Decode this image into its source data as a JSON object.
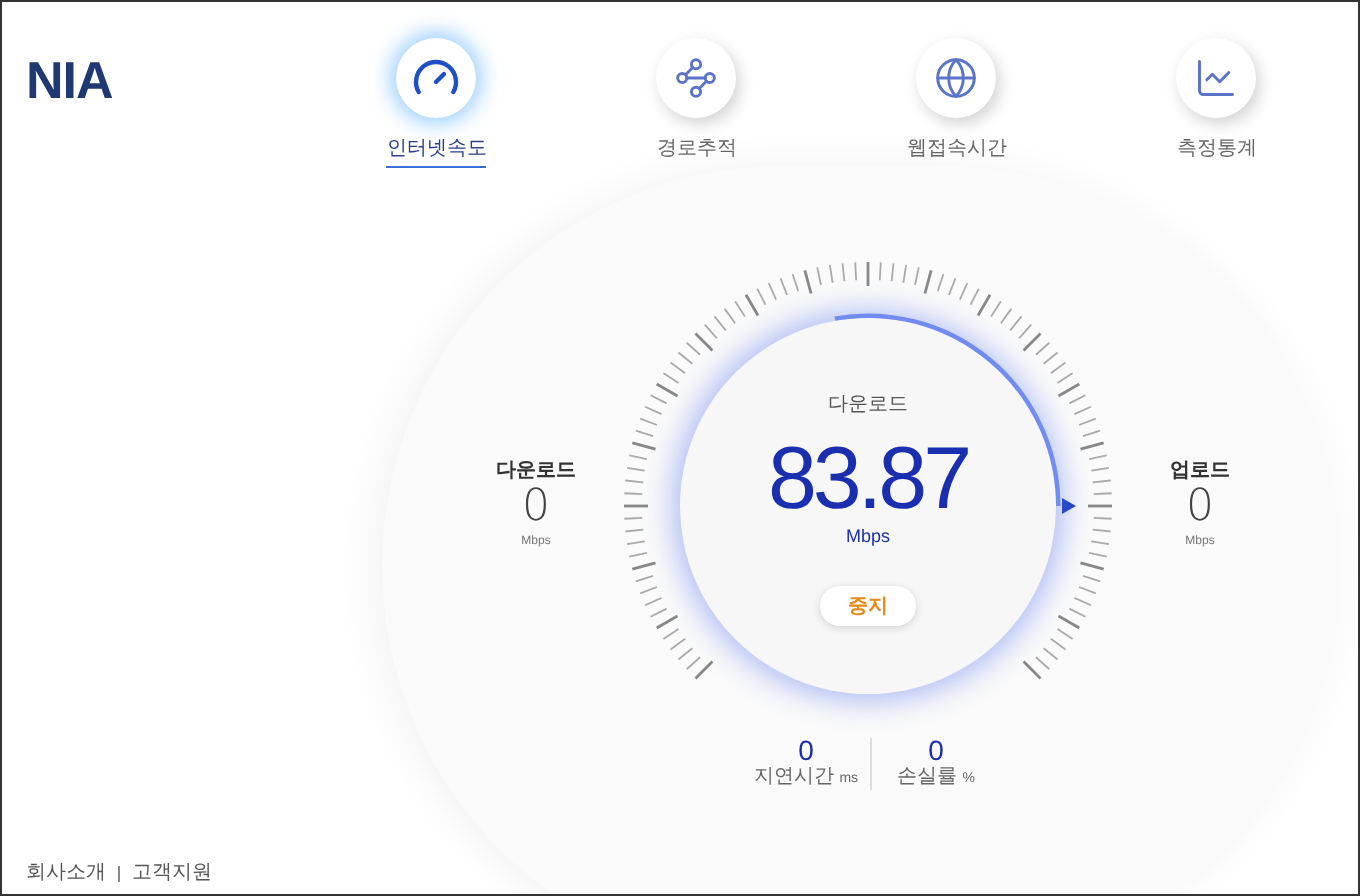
{
  "logo": "NIA",
  "tabs": [
    {
      "label": "인터넷속도",
      "selected": true
    },
    {
      "label": "경로추적",
      "selected": false
    },
    {
      "label": "웹접속시간",
      "selected": false
    },
    {
      "label": "측정통계",
      "selected": false
    }
  ],
  "download": {
    "label": "다운로드",
    "value": "0",
    "unit": "Mbps"
  },
  "upload": {
    "label": "업로드",
    "value": "0",
    "unit": "Mbps"
  },
  "gauge": {
    "label": "다운로드",
    "value": "83.87",
    "unit": "Mbps",
    "button": "중지"
  },
  "stats": [
    {
      "value": "0",
      "label": "지연시간",
      "unit": "ms"
    },
    {
      "value": "0",
      "label": "손실률",
      "unit": "%"
    }
  ],
  "footer": [
    "회사소개",
    "고객지원"
  ]
}
